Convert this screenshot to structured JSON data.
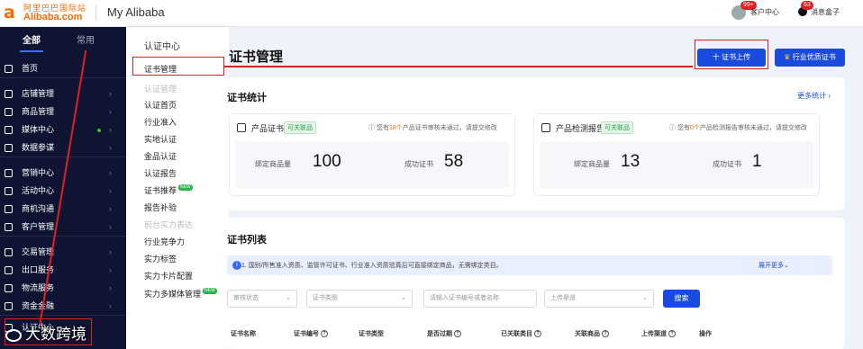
{
  "header": {
    "logo_cn": "阿里巴巴国际站",
    "logo_en": "Alibaba.com",
    "app_title": "My Alibaba",
    "user_badge": "99+",
    "user_label": "客户中心",
    "msg_badge": "63",
    "msg_label": "消息盒子"
  },
  "sidebar": {
    "tabs": [
      {
        "label": "全部",
        "active": true
      },
      {
        "label": "常用",
        "active": false
      }
    ],
    "items": [
      {
        "label": "首页",
        "icon": "home-icon"
      },
      {
        "label": "店铺管理",
        "icon": "store-icon"
      },
      {
        "label": "商品管理",
        "icon": "product-icon"
      },
      {
        "label": "媒体中心",
        "icon": "media-icon"
      },
      {
        "label": "数据参谋",
        "icon": "data-icon"
      },
      {
        "label": "营销中心",
        "icon": "marketing-icon"
      },
      {
        "label": "活动中心",
        "icon": "activity-icon"
      },
      {
        "label": "商机沟通",
        "icon": "chat-icon"
      },
      {
        "label": "客户管理",
        "icon": "customer-icon"
      },
      {
        "label": "交易管理",
        "icon": "trade-icon"
      },
      {
        "label": "出口服务",
        "icon": "export-icon"
      },
      {
        "label": "物流服务",
        "icon": "logistics-icon"
      },
      {
        "label": "资金金融",
        "icon": "finance-icon"
      },
      {
        "label": "认证中心",
        "icon": "certify-icon"
      }
    ]
  },
  "submenu": {
    "title": "认证中心",
    "items": [
      {
        "label": "证书管理",
        "muted": false,
        "new": false
      },
      {
        "label": "认证管理",
        "muted": true,
        "new": false
      },
      {
        "label": "认证首页",
        "muted": false,
        "new": false
      },
      {
        "label": "行业准入",
        "muted": false,
        "new": false
      },
      {
        "label": "实地认证",
        "muted": false,
        "new": false
      },
      {
        "label": "金品认证",
        "muted": false,
        "new": false
      },
      {
        "label": "认证报告",
        "muted": false,
        "new": false
      },
      {
        "label": "证书推荐",
        "muted": false,
        "new": true
      },
      {
        "label": "报告补验",
        "muted": false,
        "new": false
      },
      {
        "label": "前台实力表达",
        "muted": true,
        "new": false
      },
      {
        "label": "行业竞争力",
        "muted": false,
        "new": false
      },
      {
        "label": "实力标签",
        "muted": false,
        "new": false
      },
      {
        "label": "实力卡片配置",
        "muted": false,
        "new": false
      },
      {
        "label": "实力多媒体管理",
        "muted": false,
        "new": true
      }
    ],
    "new_label": "NEW"
  },
  "main": {
    "page_title": "证书管理",
    "upload_button": "十 证书上传",
    "vip_button": "行业优质证书",
    "stats": {
      "title": "证书统计",
      "more": "更多统计 ›",
      "boxes": [
        {
          "name": "产品证书",
          "tag": "可关联品",
          "warn_pre": "您有",
          "warn_num": "18个",
          "warn_post": "产品证书审核未通过，请提交修改",
          "bound_label": "绑定商品量",
          "bound_value": "100",
          "success_label": "成功证书",
          "success_value": "58"
        },
        {
          "name": "产品检测报告",
          "tag": "可关联品",
          "warn_pre": "您有",
          "warn_num": "0个",
          "warn_post": "产品检测报告审核未通过，请提交修改",
          "bound_label": "绑定商品量",
          "bound_value": "13",
          "success_label": "成功证书",
          "success_value": "1"
        }
      ]
    },
    "list": {
      "title": "证书列表",
      "notice": "1. 国别/所售准入资质、监管许可证书、行业准入资质验真后可直接绑定商品，无需绑定类目。",
      "expand": "展开更多⌄",
      "filters": [
        {
          "placeholder": "审核状态",
          "type": "select"
        },
        {
          "placeholder": "证书类型",
          "type": "select"
        },
        {
          "placeholder": "请输入证书编号或者名称",
          "type": "input"
        },
        {
          "placeholder": "上传渠道",
          "type": "select"
        }
      ],
      "search_button": "搜索",
      "columns": [
        {
          "label": "证书名称",
          "help": false
        },
        {
          "label": "证书编号",
          "help": true
        },
        {
          "label": "证书类型",
          "help": false
        },
        {
          "label": "是否过期",
          "help": true
        },
        {
          "label": "已关联类目",
          "help": true
        },
        {
          "label": "关联商品",
          "help": true
        },
        {
          "label": "上传渠道",
          "help": true
        },
        {
          "label": "操作",
          "help": false
        }
      ]
    }
  },
  "watermark": "大数跨境",
  "colors": {
    "sidebar_bg": "#0f1432",
    "accent": "#1a4bdc",
    "highlight": "#e02020",
    "brand": "#ff6a00"
  }
}
